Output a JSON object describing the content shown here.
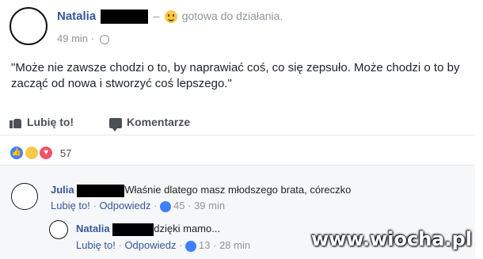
{
  "post": {
    "author": "Natalia",
    "feeling": "gotowa do działania.",
    "time": "49 min",
    "separator": "·",
    "text": "\"Może nie zawsze chodzi o to, by naprawiać coś, co się zepsuło. Może chodzi o to by zacząć od nowa i stworzyć coś lepszego.\""
  },
  "actions": {
    "like": "Lubię to!",
    "comment": "Komentarze"
  },
  "reactions": {
    "count": "57",
    "icons": [
      "like-icon",
      "haha-icon",
      "love-icon"
    ]
  },
  "comments": [
    {
      "author": "Julia",
      "text": "Właśnie dlatego masz młodszego brata, córeczko",
      "like": "Lubię to!",
      "reply": "Odpowiedz",
      "likes": "45",
      "time": "39 min"
    },
    {
      "author": "Natalia",
      "text": "dzięki mamo...",
      "like": "Lubię to!",
      "reply": "Odpowiedz",
      "likes": "13",
      "time": "28 min"
    }
  ],
  "watermark": "www.wiocha.pl",
  "colors": {
    "name": "#365899",
    "meta": "#90949c",
    "accent": "#4080ff"
  }
}
